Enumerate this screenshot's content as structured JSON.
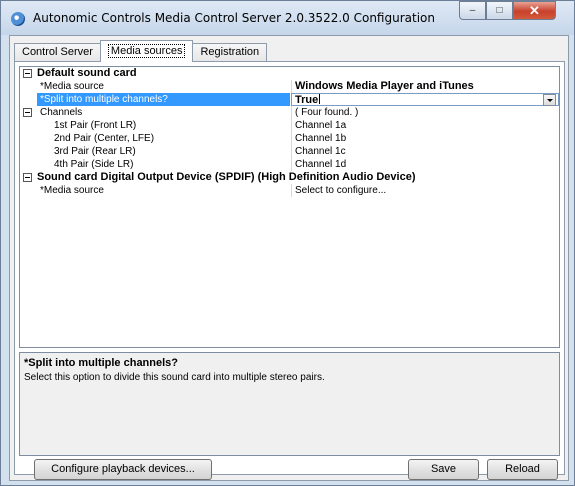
{
  "window": {
    "title": "Autonomic Controls Media Control Server 2.0.3522.0 Configuration",
    "buttons": {
      "minimize": "–",
      "maximize": "□",
      "close": "✕"
    }
  },
  "tabs": [
    {
      "label": "Control Server",
      "active": false
    },
    {
      "label": "Media sources",
      "active": true
    },
    {
      "label": "Registration",
      "active": false
    }
  ],
  "grid": {
    "category_1": "Default sound card",
    "media_source_label": "*Media source",
    "media_source_value": "Windows Media Player and iTunes",
    "split_label": "*Split into multiple channels?",
    "split_value": "True",
    "channels_label": "Channels",
    "channels_value": "( Four found. )",
    "channel_rows": [
      {
        "name": "1st Pair (Front LR)",
        "value": "Channel 1a"
      },
      {
        "name": "2nd Pair (Center, LFE)",
        "value": "Channel 1b"
      },
      {
        "name": "3rd Pair (Rear LR)",
        "value": "Channel 1c"
      },
      {
        "name": "4th Pair (Side LR)",
        "value": "Channel 1d"
      }
    ],
    "category_2": "Sound card Digital Output Device (SPDIF) (High Definition Audio Device)",
    "spdif_media_source_label": "*Media source",
    "spdif_media_source_value": "Select to configure..."
  },
  "description": {
    "title": "*Split into multiple channels?",
    "text": "Select this option to divide this sound card into multiple stereo pairs."
  },
  "buttons": {
    "configure": "Configure playback devices...",
    "save": "Save",
    "reload": "Reload"
  },
  "colors": {
    "selection": "#3399ff",
    "window_frame": "#d3e0ee",
    "close_button": "#c8412c"
  }
}
